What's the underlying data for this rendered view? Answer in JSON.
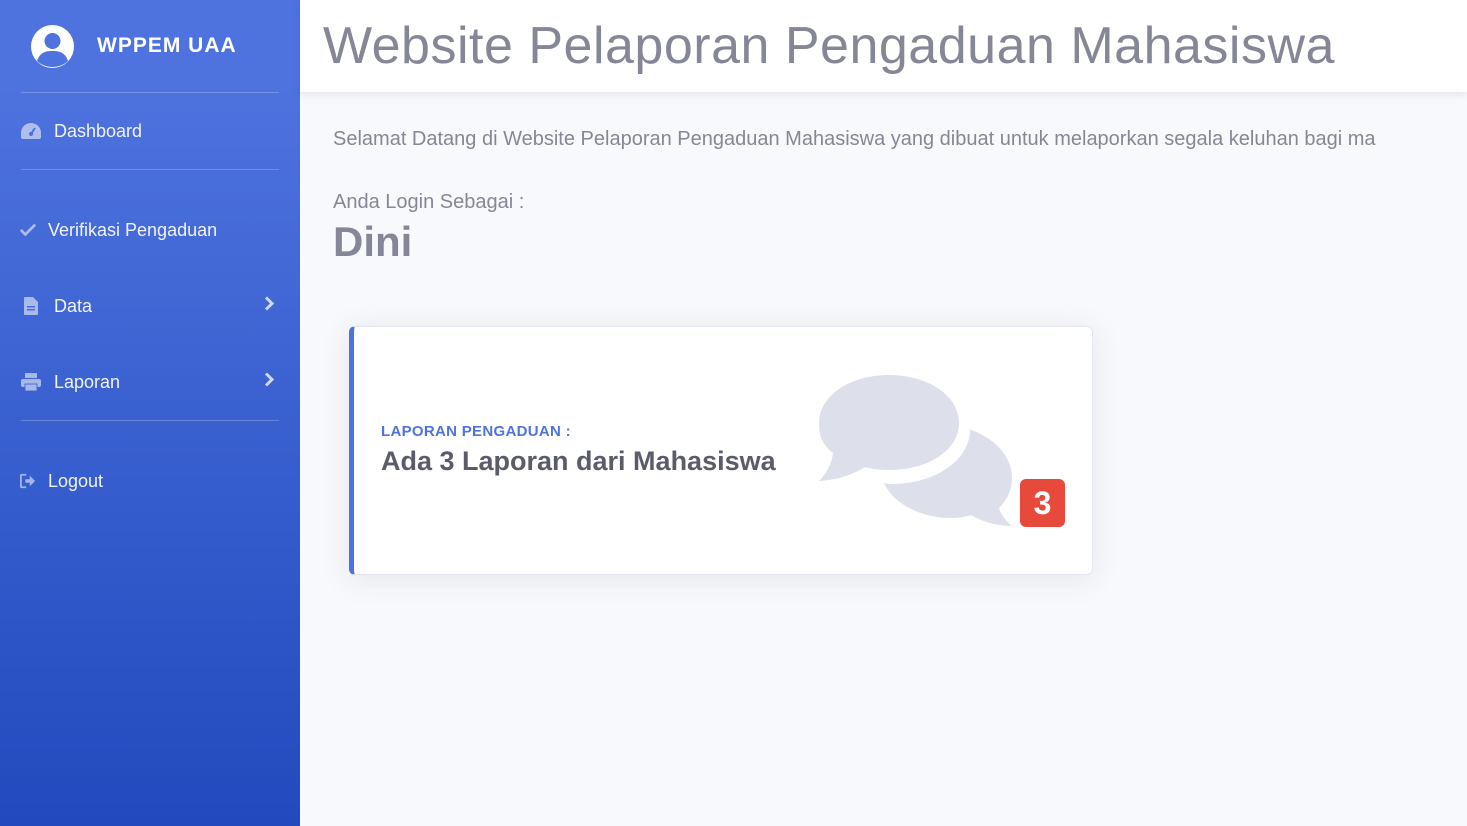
{
  "brand": {
    "name": "WPPEM UAA",
    "icon": "user-circle-icon"
  },
  "sidebar": {
    "items": [
      {
        "label": "Dashboard",
        "icon": "tachometer-icon"
      },
      {
        "label": "Verifikasi Pengaduan",
        "icon": "check-icon"
      },
      {
        "label": "Data",
        "icon": "file-icon"
      },
      {
        "label": "Laporan",
        "icon": "print-icon"
      },
      {
        "label": "Logout",
        "icon": "sign-out-icon"
      }
    ]
  },
  "header": {
    "title": "Website Pelaporan Pengaduan Mahasiswa"
  },
  "main": {
    "welcome": "Selamat Datang di Website Pelaporan Pengaduan Mahasiswa yang dibuat untuk melaporkan segala keluhan bagi ma",
    "login_label": "Anda Login Sebagai :",
    "login_name": "Dini"
  },
  "card": {
    "subtitle": "LAPORAN PENGADUAN :",
    "text": "Ada 3 Laporan dari Mahasiswa",
    "badge": "3",
    "icon": "comments-icon"
  },
  "colors": {
    "primary": "#4e73df",
    "sidebar_bottom": "#224abe",
    "danger": "#e74a3b",
    "text_muted": "#858796"
  }
}
